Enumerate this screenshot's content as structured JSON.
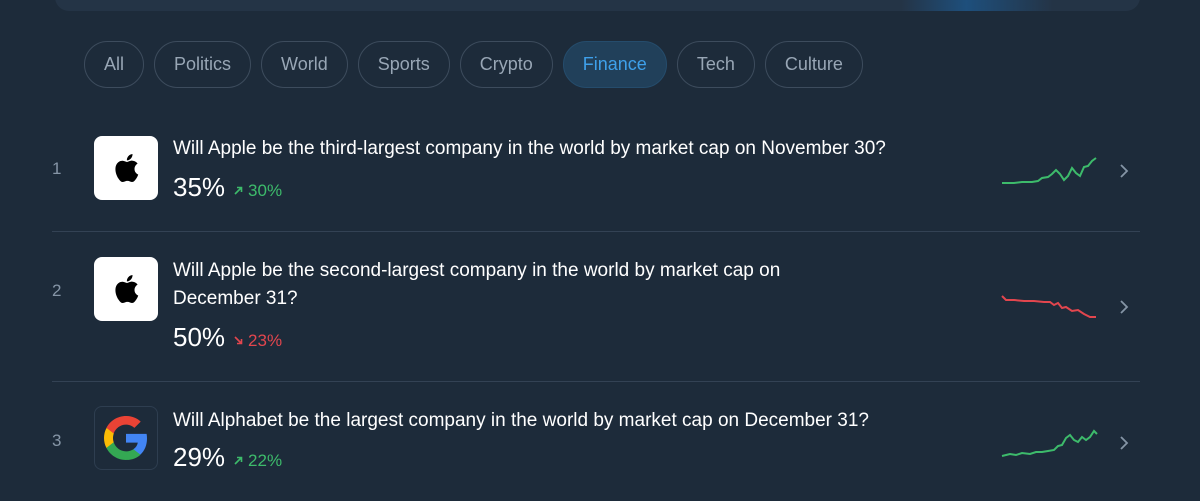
{
  "filters": [
    {
      "label": "All",
      "active": false
    },
    {
      "label": "Politics",
      "active": false
    },
    {
      "label": "World",
      "active": false
    },
    {
      "label": "Sports",
      "active": false
    },
    {
      "label": "Crypto",
      "active": false
    },
    {
      "label": "Finance",
      "active": true
    },
    {
      "label": "Tech",
      "active": false
    },
    {
      "label": "Culture",
      "active": false
    }
  ],
  "markets": [
    {
      "rank": "1",
      "logo": "apple-logo",
      "question": "Will Apple be the third-largest company in the world by market cap on November 30?",
      "percent": "35%",
      "change": "30%",
      "direction": "up",
      "trend_color": "#3dbb6b"
    },
    {
      "rank": "2",
      "logo": "apple-logo",
      "question": "Will Apple be the second-largest company in the world by market cap on December 31?",
      "percent": "50%",
      "change": "23%",
      "direction": "down",
      "trend_color": "#e2464e"
    },
    {
      "rank": "3",
      "logo": "google-logo",
      "question": "Will Alphabet be the largest company in the world by market cap on December 31?",
      "percent": "29%",
      "change": "22%",
      "direction": "up",
      "trend_color": "#3dbb6b"
    }
  ],
  "colors": {
    "background": "#1d2b3a",
    "accent": "#3ea0ea",
    "up": "#3dbb6b",
    "down": "#e2464e"
  }
}
